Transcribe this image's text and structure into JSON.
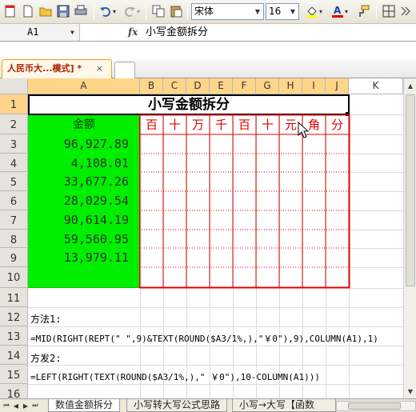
{
  "toolbar": {
    "font_name": "宋体",
    "font_size": "16",
    "icons": [
      "new-doc-icon",
      "new-icon",
      "open-folder-icon",
      "save-icon",
      "print-icon",
      "undo-icon",
      "redo-icon",
      "copy-icon",
      "paste-icon",
      "fill-color-icon",
      "font-color-icon",
      "format-painter-icon",
      "borders-icon"
    ]
  },
  "formula_bar": {
    "cell_ref": "A1",
    "fx": "fx",
    "content": "小写金额拆分"
  },
  "doc_tab": {
    "label": "人民币大...模式] *",
    "close": "×"
  },
  "columns": [
    "A",
    "B",
    "C",
    "D",
    "E",
    "F",
    "G",
    "H",
    "I",
    "J",
    "K"
  ],
  "rows": [
    "1",
    "2",
    "3",
    "4",
    "5",
    "6",
    "7",
    "8",
    "9",
    "10",
    "11",
    "12",
    "13",
    "14",
    "15",
    "16"
  ],
  "sheet": {
    "title": "小写金额拆分",
    "amount_header": "金额",
    "digit_headers": [
      "百",
      "十",
      "万",
      "千",
      "百",
      "十",
      "元",
      "角",
      "分"
    ],
    "amounts": [
      "96,927.89",
      "4,108.01",
      "33,677.26",
      "28,029.54",
      "90,614.19",
      "59,560.95",
      "13,979.11"
    ],
    "method1_label": "方法1:",
    "method1_formula": "=MID(RIGHT(REPT(\" \",9)&TEXT(ROUND($A3/1%,),\"￥0\"),9),COLUMN(A1),1)",
    "method2_label": "方发2:",
    "method2_formula": "=LEFT(RIGHT(TEXT(ROUND($A3/1%,),\" ￥0\"),10-COLUMN(A1)))"
  },
  "sheet_tabs": [
    "数值金额拆分",
    "小写转大写公式思路",
    "小写→大写【函数"
  ],
  "colors": {
    "green_fill": "#00ee00",
    "red_border": "#e00000",
    "selection_header": "#ffd58a"
  }
}
